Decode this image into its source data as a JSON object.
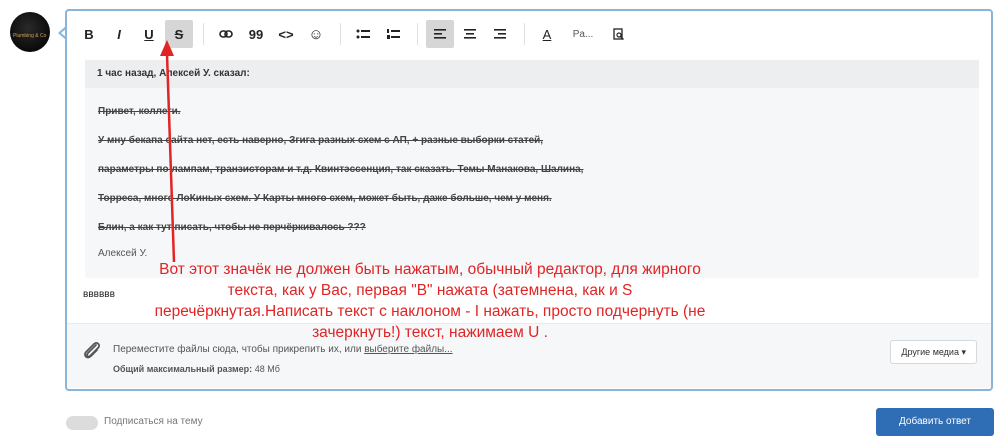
{
  "avatar": {
    "caption": "Plumbing & Co"
  },
  "toolbar": {
    "bold": "B",
    "italic": "I",
    "underline": "U",
    "strike": "S",
    "link": "⛓",
    "quote": "99",
    "code": "<>",
    "smile": "☺",
    "ul": "☰",
    "ol": "☷",
    "align_left": "≡",
    "align_center": "≡",
    "align_right": "≡",
    "font_color": "A",
    "font_size": "Pa...",
    "preview": "🔍"
  },
  "quote": {
    "header": "1 час назад, Алексей У. сказал:",
    "lines": [
      "Привет, коллеги.",
      "У мну бекапа сайта нет, есть наверно, Згига разных схем с АП,  + разные выборки статей,",
      "параметры по лампам, транзисторам и т.д. Квинтэссенция, так сказать. Темы Манакова, Шалина,",
      "Торреса, много ЛоКиных схем. У Карты много схем, может быть, даже больше, чем у меня.",
      "Блин, а как тут писать, чтобы не перчёркивалось ???"
    ],
    "author": "Алексей У."
  },
  "typed_text": "вввввв",
  "annotation": {
    "lines": [
      "Вот этот значёк не должен быть нажатым, обычный редактор, для жирного",
      "текста, как у Вас, первая \"В\" нажата (затемнена, как и S",
      "перечёркнутая.Написать текст с наклоном - I  нажать, просто подчернуть (не",
      "зачеркнуть!) текст, нажимаем U ."
    ]
  },
  "attach": {
    "text_pre": "Переместите файлы сюда, чтобы прикрепить их, или",
    "link": "выберите файлы...",
    "size_label": "Общий максимальный размер:",
    "size_value": "48 Мб",
    "media_button": "Другие медиа ▾"
  },
  "footer": {
    "subscribe": "Подписаться на тему",
    "post_button": "Добавить ответ"
  },
  "colors": {
    "annotation": "#e12424",
    "border": "#8ab4d8",
    "button": "#2f6db5"
  }
}
